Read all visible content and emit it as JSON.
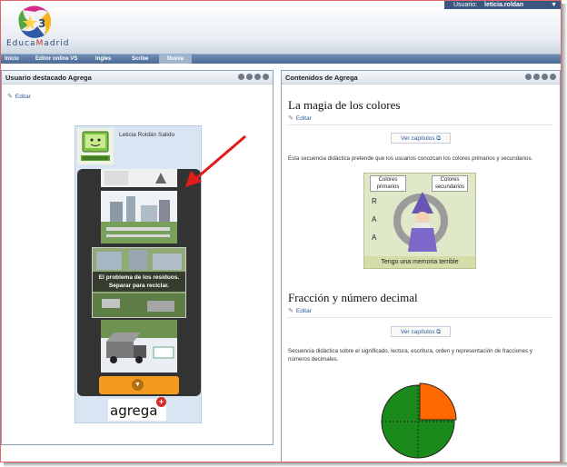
{
  "header": {
    "logo_text_pre": "Educa",
    "logo_text_m": "M",
    "logo_text_post": "adrid",
    "user_label": "Usuario:",
    "user_name": "leticia.roldan"
  },
  "nav": {
    "tabs": [
      {
        "label": "Inicio"
      },
      {
        "label": "Editor online VS"
      },
      {
        "label": "Ingles"
      },
      {
        "label": "Scribe"
      },
      {
        "label": "Nueva"
      }
    ]
  },
  "left_panel": {
    "title": "Usuario destacado Agrega",
    "editar": "Editar",
    "author": "Leticia Roldán Salido",
    "slide_caption_1": "El problema de los residuos.",
    "slide_caption_2": "Separar para reciclar.",
    "logo_word": "agrega",
    "logo_plus": "+"
  },
  "right_panel": {
    "title": "Contenidos de Agrega",
    "items": [
      {
        "title": "La magia de los colores",
        "editar": "Editar",
        "ver": "Ver capítulos",
        "desc": "Esta secuencia didáctica pretende que los usuarios conozcan los colores primarios y secundarios.",
        "image": {
          "col1": "Colores primarios",
          "col2": "Colores secundarios",
          "letters": [
            "R",
            "A",
            "A"
          ],
          "bottom": "Tengo una memoria terrible"
        }
      },
      {
        "title": "Fracción y número decimal",
        "editar": "Editar",
        "ver": "Ver capítulos",
        "desc": "Secuencia didáctica sobre el significado, lectura, escritura, orden y representación de fracciones y números decimales."
      }
    ]
  },
  "colors": {
    "nav": "#4a6a96",
    "accent_orange": "#f29b1f",
    "pie_green": "#1a8a1a",
    "pie_orange": "#ff6a00",
    "link": "#2d5b9a"
  }
}
